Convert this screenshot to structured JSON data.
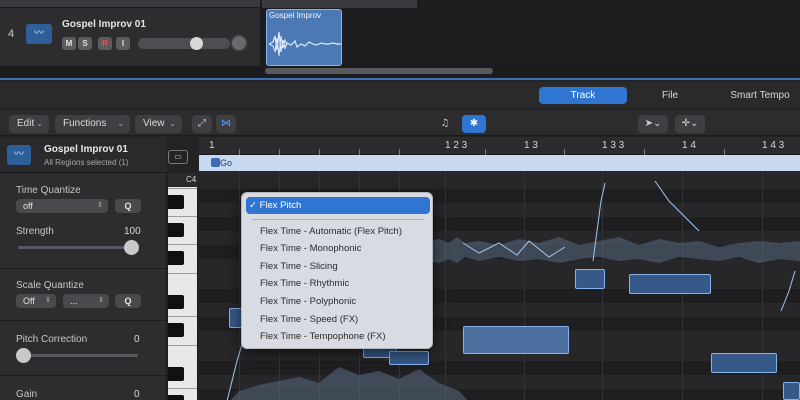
{
  "track": {
    "number": "4",
    "name": "Gospel Improv 01",
    "icon": "waveform-icon",
    "buttons": [
      "M",
      "S",
      "R",
      "I"
    ]
  },
  "region": {
    "label": "Gospel Improv"
  },
  "editor_tabs": [
    {
      "label": "Track",
      "active": true
    },
    {
      "label": "File",
      "active": false
    },
    {
      "label": "Smart Tempo",
      "active": false
    }
  ],
  "toolbar": {
    "edit": "Edit",
    "functions": "Functions",
    "view": "View"
  },
  "inspector": {
    "region_name": "Gospel Improv 01",
    "subtitle": "All Regions selected (1)",
    "time_quantize": {
      "label": "Time Quantize",
      "value": "off",
      "q": "Q"
    },
    "strength": {
      "label": "Strength",
      "value": "100",
      "level": 1.0
    },
    "scale_quantize": {
      "label": "Scale Quantize",
      "value": "Off",
      "scale": "...",
      "q": "Q"
    },
    "pitch_correction": {
      "label": "Pitch Correction",
      "value": "0",
      "level": 0.0
    },
    "gain": {
      "label": "Gain",
      "value": "0"
    }
  },
  "piano": {
    "c4_label": "C4"
  },
  "ruler": [
    "1",
    "1 2 3",
    "1 3",
    "1 3 3",
    "1 4",
    "1 4 3"
  ],
  "region_bar_label": "Go",
  "flex_menu": {
    "checked_item": "✓ Flex Pitch",
    "items": [
      "Flex Time - Automatic (Flex Pitch)",
      "Flex Time - Monophonic",
      "Flex Time - Slicing",
      "Flex Time - Rhythmic",
      "Flex Time - Polyphonic",
      "Flex Time - Speed (FX)",
      "Flex Time - Tempophone (FX)"
    ]
  },
  "colors": {
    "accent": "#2f76d2",
    "region": "#4b79b4",
    "note_fill": "#36598a",
    "note_border": "#86b4ea"
  }
}
